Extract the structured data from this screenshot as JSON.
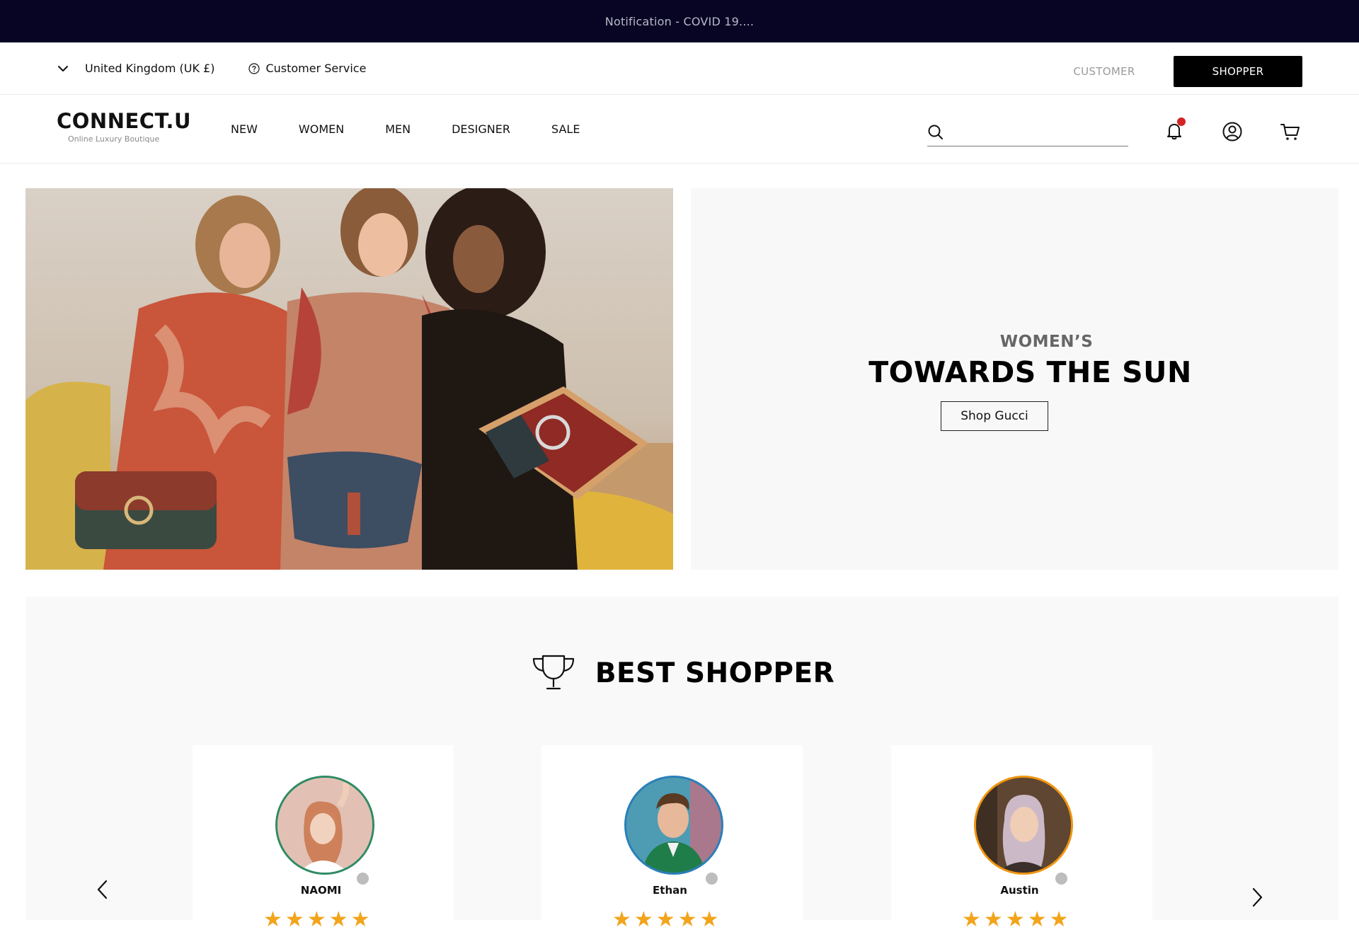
{
  "notification": {
    "text": "Notification - COVID 19...."
  },
  "utility": {
    "region_label": "United Kingdom (UK £)",
    "customer_service_label": "Customer Service",
    "customer_label": "CUSTOMER",
    "shopper_label": "SHOPPER"
  },
  "brand": {
    "name": "CONNECT.U",
    "tagline": "Online Luxury Boutique"
  },
  "nav": {
    "items": [
      {
        "label": "NEW"
      },
      {
        "label": "WOMEN"
      },
      {
        "label": "MEN"
      },
      {
        "label": "DESIGNER"
      },
      {
        "label": "SALE"
      }
    ],
    "search_placeholder": ""
  },
  "hero": {
    "subtitle": "WOMEN’S",
    "title": "TOWARDS THE SUN",
    "cta_label": "Shop Gucci"
  },
  "best_shopper": {
    "title": "BEST SHOPPER",
    "cards": [
      {
        "name": "NAOMI",
        "rating": 5,
        "ring_color": "#2e8b64"
      },
      {
        "name": "Ethan",
        "rating": 5,
        "ring_color": "#2a7fb8"
      },
      {
        "name": "Austin",
        "rating": 5,
        "ring_color": "#f0950e"
      }
    ]
  },
  "colors": {
    "notification_bg": "#070523",
    "accent_dark": "#000000",
    "star": "#f2a41c",
    "alert_dot": "#d32525"
  },
  "icons": [
    "chevron-down-icon",
    "help-circle-icon",
    "search-icon",
    "bell-icon",
    "user-icon",
    "cart-icon",
    "trophy-icon",
    "chevron-left-icon",
    "chevron-right-icon"
  ]
}
